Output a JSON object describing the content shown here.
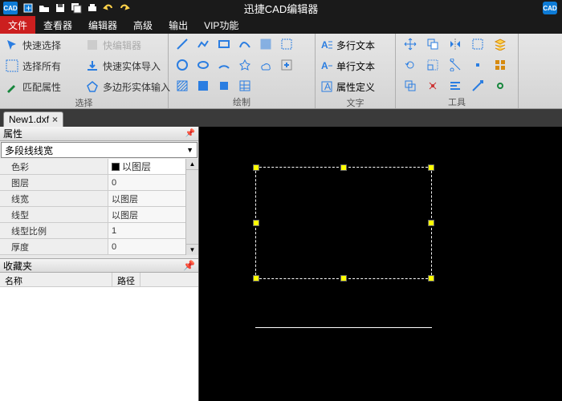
{
  "window": {
    "title": "迅捷CAD编辑器"
  },
  "menu": {
    "tabs": [
      "文件",
      "查看器",
      "编辑器",
      "高级",
      "输出",
      "VIP功能"
    ],
    "active": 0
  },
  "ribbon": {
    "select": {
      "label": "选择",
      "quick_select": "快速选择",
      "quick_edit": "快编辑器",
      "select_all": "选择所有",
      "quick_entity_import": "快速实体导入",
      "match_props": "匹配属性",
      "poly_entity_input": "多边形实体输入"
    },
    "draw": {
      "label": "绘制"
    },
    "text": {
      "label": "文字",
      "multiline": "多行文本",
      "singleline": "单行文本",
      "attrdef": "属性定义"
    },
    "tools": {
      "label": "工具"
    }
  },
  "doc": {
    "tab": "New1.dxf"
  },
  "props": {
    "title": "属性",
    "combo": "多段线线宽",
    "rows": [
      {
        "k": "色彩",
        "v": "以图层",
        "drop": true,
        "swatch": true
      },
      {
        "k": "图层",
        "v": "0"
      },
      {
        "k": "线宽",
        "v": "以图层"
      },
      {
        "k": "线型",
        "v": "以图层"
      },
      {
        "k": "线型比例",
        "v": "1"
      },
      {
        "k": "厚度",
        "v": "0"
      }
    ]
  },
  "fav": {
    "title": "收藏夹",
    "col_name": "名称",
    "col_path": "路径"
  }
}
